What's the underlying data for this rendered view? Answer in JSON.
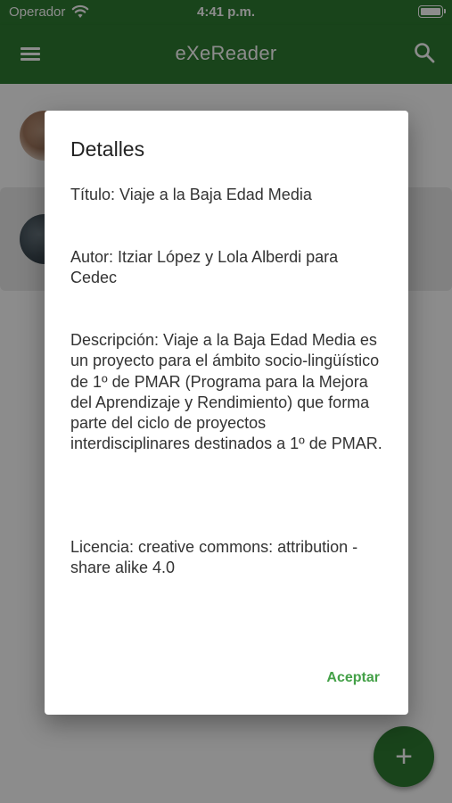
{
  "status_bar": {
    "carrier": "Operador",
    "time": "4:41 p.m."
  },
  "app_bar": {
    "title": "eXeReader",
    "menu_icon": "menu-icon",
    "search_icon": "search-icon"
  },
  "colors": {
    "primary": "#2e7d32",
    "accent": "#43a047"
  },
  "dialog": {
    "title": "Detalles",
    "title_field": "Título: Viaje a la Baja Edad Media",
    "author_field": "Autor: Itziar López y Lola Alberdi para Cedec",
    "description_field": "Descripción: Viaje a la Baja Edad Media es un proyecto para el ámbito socio-lingüístico de 1º de PMAR (Programa para la Mejora del Aprendizaje y Rendimiento) que forma parte del ciclo de proyectos interdisciplinares destinados a 1º de PMAR.",
    "license_field": "Licencia: creative commons: attribution - share alike 4.0",
    "accept_label": "Aceptar"
  },
  "fab": {
    "label": "+",
    "icon": "add-icon"
  }
}
